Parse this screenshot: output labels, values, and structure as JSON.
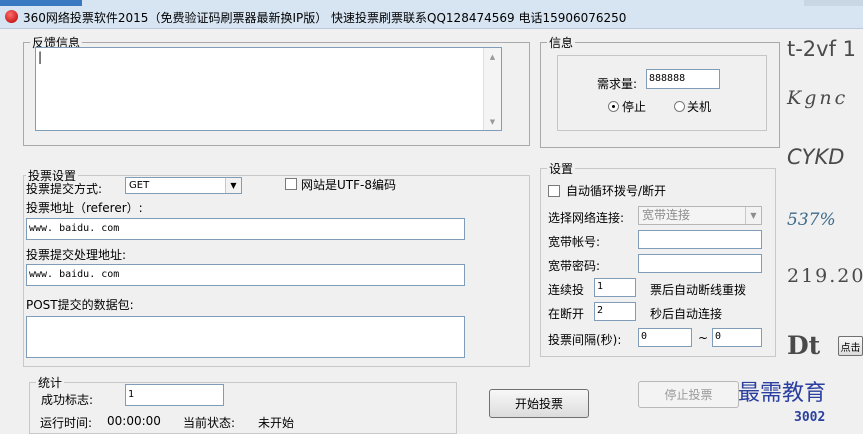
{
  "window": {
    "title": "360网络投票软件2015（免费验证码刷票器最新换IP版）   快速投票刷票联系QQ128474569 电话15906076250"
  },
  "feedback": {
    "legend": "反馈信息",
    "text": "|"
  },
  "info": {
    "legend": "信息",
    "required_label": "需求量:",
    "required_value": "888888",
    "radio_stop": "停止",
    "radio_shutdown": "关机"
  },
  "vote_settings": {
    "legend": "投票设置",
    "method_label": "投票提交方式:",
    "method_value": "GET",
    "utf8_label": "网站是UTF-8编码",
    "referer_label": "投票地址（referer）:",
    "referer_value": "www. baidu. com",
    "handler_label": "投票提交处理地址:",
    "handler_value": "www. baidu. com",
    "post_label": "POST提交的数据包:",
    "post_value": ""
  },
  "settings": {
    "legend": "设置",
    "auto_redial_label": "自动循环拨号/断开",
    "network_label": "选择网络连接:",
    "network_value": "宽带连接",
    "account_label": "宽带帐号:",
    "account_value": "",
    "password_label": "宽带密码:",
    "password_value": "",
    "continuous_label": "连续投",
    "continuous_value": "1",
    "continuous_suffix": "票后自动断线重拨",
    "reconnect_label": "在断开",
    "reconnect_value": "2",
    "reconnect_suffix": "秒后自动连接",
    "interval_label": "投票间隔(秒):",
    "interval_from": "0",
    "interval_sep": "~",
    "interval_to": "0"
  },
  "stats": {
    "legend": "统计",
    "success_label": "成功标志:",
    "success_value": "1",
    "runtime_label": "运行时间:",
    "runtime_value": "00:00:00",
    "status_label": "当前状态:",
    "status_value": "未开始"
  },
  "buttons": {
    "start": "开始投票",
    "stop": "停止投票",
    "click_hint": "点击"
  },
  "captchas": [
    "t-2vf 1",
    "Kgnc",
    "CYKD",
    "537%",
    "219.20",
    "Dt"
  ],
  "watermark": "最需教育",
  "code": "3002"
}
